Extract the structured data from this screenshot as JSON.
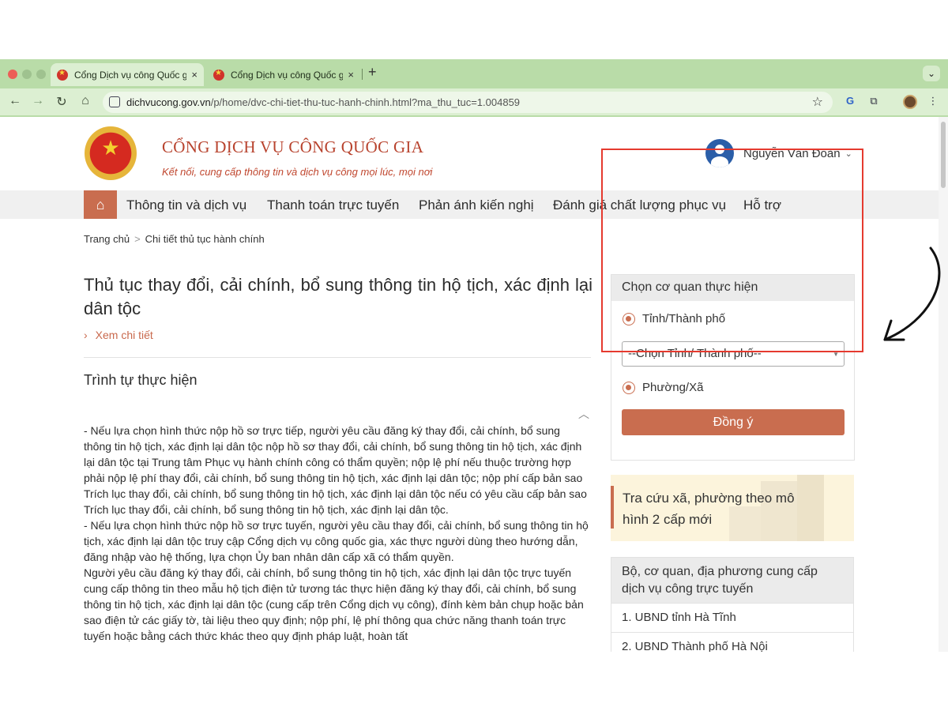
{
  "browser": {
    "tabs": [
      {
        "title": "Cổng Dịch vụ công Quốc gia",
        "close": "×"
      },
      {
        "title": "Cổng Dịch vụ công Quốc gia",
        "close": "×"
      }
    ],
    "new_tab": "+",
    "tab_menu": "⌄",
    "nav": {
      "back": "←",
      "forward": "→",
      "reload": "↻",
      "home": "⌂"
    },
    "url": {
      "domain": "dichvucong.gov.vn",
      "path": "/p/home/dvc-chi-tiet-thu-tuc-hanh-chinh.html?ma_thu_tuc=1.004859"
    },
    "bookmark": "☆",
    "extensions": [
      "translate-icon",
      "puzzle-icon",
      "profile-avatar",
      "menu-icon"
    ],
    "ext_glyphs": {
      "translate": "G",
      "puzzle": "⧉",
      "menu": "⋮"
    }
  },
  "header": {
    "emblem_glyph": "★",
    "title": "CỔNG DỊCH VỤ CÔNG QUỐC GIA",
    "subtitle": "Kết nối, cung cấp thông tin và dịch vụ công mọi lúc, mọi nơi",
    "user_name": "Nguyễn Văn Đoàn",
    "user_caret": "⌄"
  },
  "nav": {
    "home_icon": "⌂",
    "items": [
      "Thông tin và dịch vụ",
      "Thanh toán trực tuyến",
      "Phản ánh kiến nghị",
      "Đánh giá chất lượng phục vụ",
      "Hỗ trợ"
    ]
  },
  "breadcrumb": {
    "home": "Trang chủ",
    "sep": ">",
    "current": "Chi tiết thủ tục hành chính"
  },
  "procedure": {
    "title": "Thủ tục thay đổi, cải chính, bổ sung thông tin hộ tịch, xác định lại dân tộc",
    "see_detail": "Xem chi tiết",
    "see_detail_chevron": "›",
    "section_title": "Trình tự thực hiện",
    "collapse_icon": "︿",
    "paragraphs": [
      "- Nếu lựa chọn hình thức nộp hồ sơ trực tiếp, người yêu cầu đăng ký thay đổi, cải chính, bổ sung thông tin hộ tịch, xác định lại dân tộc nộp hồ sơ thay đổi, cải chính, bổ sung thông tin hộ tịch, xác định lại dân tộc tại Trung tâm Phục vụ hành chính công có thẩm quyền; nộp lệ phí nếu thuộc trường hợp phải nộp lệ phí thay đổi, cải chính, bổ sung thông tin hộ tịch, xác định lại dân tộc; nộp phí cấp bản sao Trích lục thay đổi, cải chính, bổ sung thông tin hộ tịch, xác định lại dân tộc nếu có yêu cầu cấp bản sao Trích lục thay đổi, cải chính, bổ sung thông tin hộ tịch, xác định lại dân tộc.",
      "- Nếu lựa chọn hình thức nộp hồ sơ trực tuyến, người yêu cầu thay đổi, cải chính, bổ sung thông tin hộ tịch, xác định lại dân tộc truy cập Cổng dịch vụ công quốc gia, xác thực người dùng theo hướng dẫn, đăng nhập vào hệ thống, lựa chọn Ủy ban nhân dân cấp xã có thẩm quyền.",
      "Người yêu cầu đăng ký thay đổi, cải chính, bổ sung thông tin hộ tịch, xác định lại dân tộc trực tuyến cung cấp thông tin theo mẫu hộ tịch điện tử tương tác thực hiện đăng ký thay đổi, cải chính, bổ sung thông tin hộ tịch, xác định lại dân tộc (cung cấp trên Cổng dịch vụ công), đính kèm bản chụp hoặc bản sao điện tử các giấy tờ, tài liệu theo quy định; nộp phí, lệ phí thông qua chức năng thanh toán trực tuyến hoặc bằng cách thức khác theo quy định pháp luật, hoàn tất"
    ]
  },
  "agency_selector": {
    "title": "Chọn cơ quan thực hiện",
    "option_province": "Tỉnh/Thành phố",
    "select_placeholder": "--Chọn Tỉnh/ Thành phố--",
    "select_caret": "▼",
    "option_ward": "Phường/Xã",
    "submit": "Đồng ý"
  },
  "lookup_banner": {
    "text": "Tra cứu xã, phường theo mô hình 2 cấp mới"
  },
  "agencies": {
    "title": "Bộ, cơ quan, địa phương cung cấp dịch vụ công trực tuyến",
    "items": [
      "1. UBND tỉnh Hà Tĩnh",
      "2. UBND Thành phố Hà Nội"
    ]
  },
  "colors": {
    "accent": "#c96d4f",
    "brand": "#b8432e",
    "chrome": "#b9dca8",
    "highlight": "#e53a2f"
  }
}
